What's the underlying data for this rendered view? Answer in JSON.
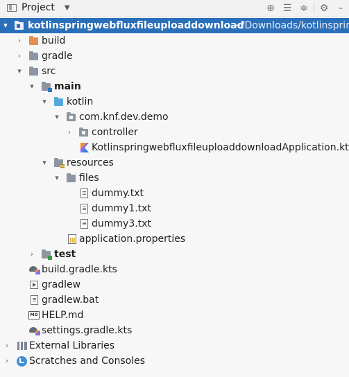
{
  "toolbar": {
    "title": "Project",
    "caret": "▼",
    "icons": [
      "locate-icon",
      "expand-all-icon",
      "collapse-all-icon",
      "settings-icon",
      "hide-icon"
    ]
  },
  "tree": {
    "root": {
      "name": "kotlinspringwebfluxfileuploaddownload",
      "path": "~/Downloads/kotlinsprin"
    },
    "build": "build",
    "gradle": "gradle",
    "src": "src",
    "main": "main",
    "kotlin": "kotlin",
    "package": "com.knf.dev.demo",
    "controller": "controller",
    "app_file": "KotlinspringwebfluxfileuploaddownloadApplication.kt",
    "resources": "resources",
    "files": "files",
    "dummy": "dummy.txt",
    "dummy1": "dummy1.txt",
    "dummy3": "dummy3.txt",
    "app_props": "application.properties",
    "test": "test",
    "build_gradle": "build.gradle.kts",
    "gradlew": "gradlew",
    "gradlew_bat": "gradlew.bat",
    "help": "HELP.md",
    "settings_gradle": "settings.gradle.kts",
    "external_libraries": "External Libraries",
    "scratches": "Scratches and Consoles"
  },
  "colors": {
    "selection": "#2a6fba",
    "background": "#f7f7f7"
  }
}
